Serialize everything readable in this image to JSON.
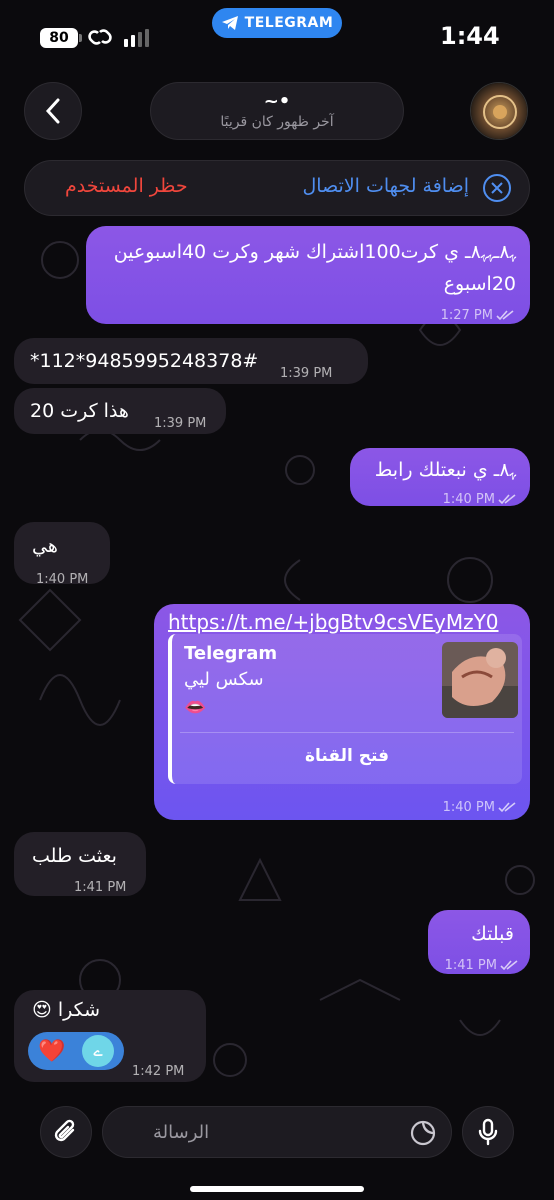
{
  "status": {
    "battery": "80",
    "badge": "TELEGRAM",
    "time": "1:44"
  },
  "header": {
    "name": "~•",
    "last_seen": "آخر ظهور كان قريبًا"
  },
  "actions": {
    "add_contact": "إضافة لجهات الاتصال",
    "block_user": "حظر المستخدم"
  },
  "messages": [
    {
      "dir": "out",
      "lines": [
        "ﮩ٨ـﮩﮩ٨ـ ي كرت100اشتراك شهر وكرت 40اسبوعين",
        "20اسبوع"
      ],
      "time": "1:27 PM"
    },
    {
      "dir": "in",
      "text": "*112*9485995248378#",
      "time": "1:39 PM"
    },
    {
      "dir": "in",
      "text": "هذا كرت 20",
      "time": "1:39 PM"
    },
    {
      "dir": "out",
      "text": "ﮩ٨ـ ي نبعتلك رابط",
      "time": "1:40 PM"
    },
    {
      "dir": "in",
      "text": "هي",
      "time": "1:40 PM"
    },
    {
      "dir": "out",
      "link": "https://t.me/+jbgBtv9csVEyMzY0",
      "preview": {
        "site": "Telegram",
        "title": "سكس ليي",
        "emoji": "👄",
        "button": "فتح القناة"
      },
      "time": "1:40 PM"
    },
    {
      "dir": "in",
      "text": "بعثت طلب",
      "time": "1:41 PM"
    },
    {
      "dir": "out",
      "text": "قبلتك",
      "time": "1:41 PM"
    },
    {
      "dir": "in",
      "text": "شكرا 😍",
      "time": "1:42 PM",
      "reaction": {
        "emoji": "❤️",
        "avatar_letter": "ے"
      }
    }
  ],
  "composer": {
    "placeholder": "الرسالة"
  },
  "colors": {
    "outgoing": "#8c57e6",
    "incoming": "#231f27",
    "accent": "#4f8ef0",
    "danger": "#f0463c"
  }
}
